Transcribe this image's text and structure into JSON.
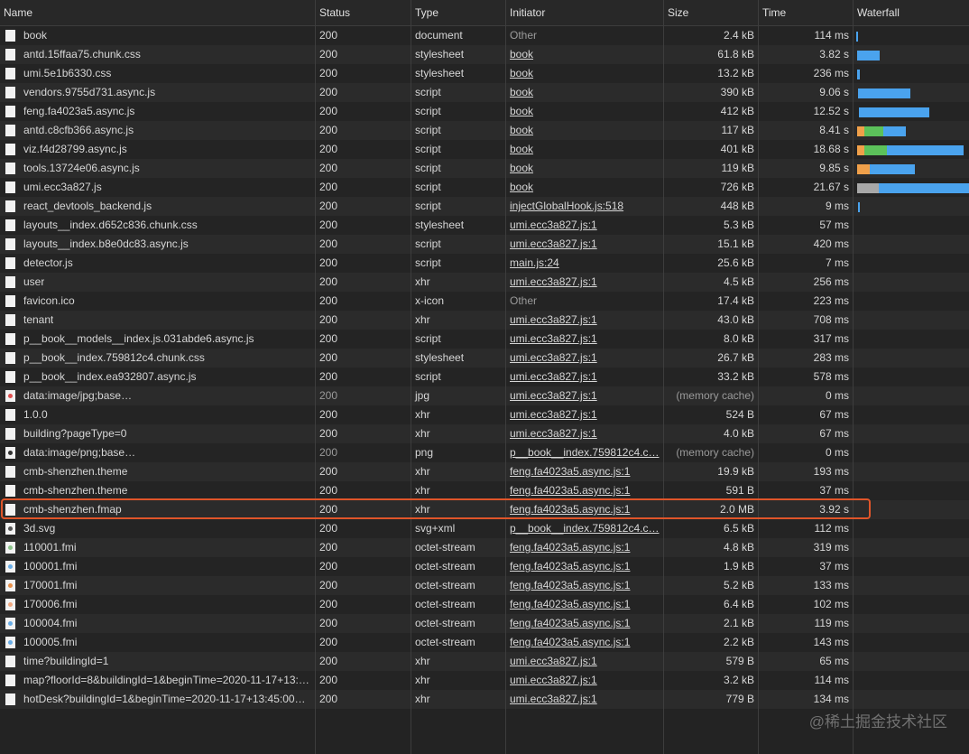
{
  "columns": [
    "Name",
    "Status",
    "Type",
    "Initiator",
    "Size",
    "Time",
    "Waterfall"
  ],
  "colors": {
    "blue": "#4aa3ee",
    "green": "#5cc15a",
    "orange": "#f0a04a",
    "gray": "#a8a8a8",
    "highlight": "#e0552a"
  },
  "rows": [
    {
      "name": "book",
      "status": "200",
      "type": "document",
      "initiator": "Other",
      "size": "2.4 kB",
      "time": "114 ms",
      "icon": "doc",
      "wf": [
        [
          "blue",
          2,
          2
        ]
      ]
    },
    {
      "name": "antd.15ffaa75.chunk.css",
      "status": "200",
      "type": "stylesheet",
      "initiator": "book",
      "size": "61.8 kB",
      "time": "3.82 s",
      "icon": "doc",
      "wf": [
        [
          "blue",
          3,
          20
        ]
      ]
    },
    {
      "name": "umi.5e1b6330.css",
      "status": "200",
      "type": "stylesheet",
      "initiator": "book",
      "size": "13.2 kB",
      "time": "236 ms",
      "icon": "doc",
      "wf": [
        [
          "blue",
          3,
          2.5
        ]
      ]
    },
    {
      "name": "vendors.9755d731.async.js",
      "status": "200",
      "type": "script",
      "initiator": "book",
      "size": "390 kB",
      "time": "9.06 s",
      "icon": "doc",
      "wf": [
        [
          "blue",
          4,
          45
        ]
      ]
    },
    {
      "name": "feng.fa4023a5.async.js",
      "status": "200",
      "type": "script",
      "initiator": "book",
      "size": "412 kB",
      "time": "12.52 s",
      "icon": "doc",
      "wf": [
        [
          "blue",
          5,
          61
        ]
      ]
    },
    {
      "name": "antd.c8cfb366.async.js",
      "status": "200",
      "type": "script",
      "initiator": "book",
      "size": "117 kB",
      "time": "8.41 s",
      "icon": "doc",
      "wf": [
        [
          "orange",
          3,
          6
        ],
        [
          "green",
          9,
          17
        ],
        [
          "blue",
          26,
          19
        ]
      ]
    },
    {
      "name": "viz.f4d28799.async.js",
      "status": "200",
      "type": "script",
      "initiator": "book",
      "size": "401 kB",
      "time": "18.68 s",
      "icon": "doc",
      "wf": [
        [
          "orange",
          3,
          6
        ],
        [
          "green",
          9,
          20
        ],
        [
          "blue",
          29,
          66
        ]
      ]
    },
    {
      "name": "tools.13724e06.async.js",
      "status": "200",
      "type": "script",
      "initiator": "book",
      "size": "119 kB",
      "time": "9.85 s",
      "icon": "doc",
      "wf": [
        [
          "orange",
          3,
          11
        ],
        [
          "blue",
          14,
          39
        ]
      ]
    },
    {
      "name": "umi.ecc3a827.js",
      "status": "200",
      "type": "script",
      "initiator": "book",
      "size": "726 kB",
      "time": "21.67 s",
      "icon": "doc",
      "wf": [
        [
          "gray",
          3,
          19
        ],
        [
          "blue",
          22,
          78
        ]
      ]
    },
    {
      "name": "react_devtools_backend.js",
      "status": "200",
      "type": "script",
      "initiator": "injectGlobalHook.js:518",
      "size": "448 kB",
      "time": "9 ms",
      "icon": "doc",
      "wf": [
        [
          "blue",
          4,
          1.5
        ]
      ]
    },
    {
      "name": "layouts__index.d652c836.chunk.css",
      "status": "200",
      "type": "stylesheet",
      "initiator": "umi.ecc3a827.js:1",
      "size": "5.3 kB",
      "time": "57 ms",
      "icon": "doc",
      "wf": []
    },
    {
      "name": "layouts__index.b8e0dc83.async.js",
      "status": "200",
      "type": "script",
      "initiator": "umi.ecc3a827.js:1",
      "size": "15.1 kB",
      "time": "420 ms",
      "icon": "doc",
      "wf": []
    },
    {
      "name": "detector.js",
      "status": "200",
      "type": "script",
      "initiator": "main.js:24",
      "size": "25.6 kB",
      "time": "7 ms",
      "icon": "doc",
      "wf": []
    },
    {
      "name": "user",
      "status": "200",
      "type": "xhr",
      "initiator": "umi.ecc3a827.js:1",
      "size": "4.5 kB",
      "time": "256 ms",
      "icon": "blank",
      "wf": []
    },
    {
      "name": "favicon.ico",
      "status": "200",
      "type": "x-icon",
      "initiator": "Other",
      "size": "17.4 kB",
      "time": "223 ms",
      "icon": "blank",
      "wf": []
    },
    {
      "name": "tenant",
      "status": "200",
      "type": "xhr",
      "initiator": "umi.ecc3a827.js:1",
      "size": "43.0 kB",
      "time": "708 ms",
      "icon": "blank",
      "wf": []
    },
    {
      "name": "p__book__models__index.js.031abde6.async.js",
      "status": "200",
      "type": "script",
      "initiator": "umi.ecc3a827.js:1",
      "size": "8.0 kB",
      "time": "317 ms",
      "icon": "doc",
      "wf": []
    },
    {
      "name": "p__book__index.759812c4.chunk.css",
      "status": "200",
      "type": "stylesheet",
      "initiator": "umi.ecc3a827.js:1",
      "size": "26.7 kB",
      "time": "283 ms",
      "icon": "doc",
      "wf": []
    },
    {
      "name": "p__book__index.ea932807.async.js",
      "status": "200",
      "type": "script",
      "initiator": "umi.ecc3a827.js:1",
      "size": "33.2 kB",
      "time": "578 ms",
      "icon": "doc",
      "wf": []
    },
    {
      "name": "data:image/jpg;base…",
      "status": "200",
      "type": "jpg",
      "initiator": "umi.ecc3a827.js:1",
      "size": "(memory cache)",
      "time": "0 ms",
      "icon": "jpg",
      "dim": true,
      "wf": []
    },
    {
      "name": "1.0.0",
      "status": "200",
      "type": "xhr",
      "initiator": "umi.ecc3a827.js:1",
      "size": "524 B",
      "time": "67 ms",
      "icon": "blank",
      "wf": []
    },
    {
      "name": "building?pageType=0",
      "status": "200",
      "type": "xhr",
      "initiator": "umi.ecc3a827.js:1",
      "size": "4.0 kB",
      "time": "67 ms",
      "icon": "blank",
      "wf": []
    },
    {
      "name": "data:image/png;base…",
      "status": "200",
      "type": "png",
      "initiator": "p__book__index.759812c4.c…",
      "size": "(memory cache)",
      "time": "0 ms",
      "icon": "png",
      "dim": true,
      "wf": []
    },
    {
      "name": "cmb-shenzhen.theme",
      "status": "200",
      "type": "xhr",
      "initiator": "feng.fa4023a5.async.js:1",
      "size": "19.9 kB",
      "time": "193 ms",
      "icon": "blank",
      "wf": []
    },
    {
      "name": "cmb-shenzhen.theme",
      "status": "200",
      "type": "xhr",
      "initiator": "feng.fa4023a5.async.js:1",
      "size": "591 B",
      "time": "37 ms",
      "icon": "blank",
      "wf": []
    },
    {
      "name": "cmb-shenzhen.fmap",
      "status": "200",
      "type": "xhr",
      "initiator": "feng.fa4023a5.async.js:1",
      "size": "2.0 MB",
      "time": "3.92 s",
      "icon": "blank",
      "wf": []
    },
    {
      "name": "3d.svg",
      "status": "200",
      "type": "svg+xml",
      "initiator": "p__book__index.759812c4.c…",
      "size": "6.5 kB",
      "time": "112 ms",
      "icon": "svg",
      "wf": []
    },
    {
      "name": "110001.fmi",
      "status": "200",
      "type": "octet-stream",
      "initiator": "feng.fa4023a5.async.js:1",
      "size": "4.8 kB",
      "time": "319 ms",
      "icon": "green",
      "wf": []
    },
    {
      "name": "100001.fmi",
      "status": "200",
      "type": "octet-stream",
      "initiator": "feng.fa4023a5.async.js:1",
      "size": "1.9 kB",
      "time": "37 ms",
      "icon": "lblue",
      "wf": []
    },
    {
      "name": "170001.fmi",
      "status": "200",
      "type": "octet-stream",
      "initiator": "feng.fa4023a5.async.js:1",
      "size": "5.2 kB",
      "time": "133 ms",
      "icon": "orange",
      "wf": []
    },
    {
      "name": "170006.fmi",
      "status": "200",
      "type": "octet-stream",
      "initiator": "feng.fa4023a5.async.js:1",
      "size": "6.4 kB",
      "time": "102 ms",
      "icon": "peach",
      "wf": []
    },
    {
      "name": "100004.fmi",
      "status": "200",
      "type": "octet-stream",
      "initiator": "feng.fa4023a5.async.js:1",
      "size": "2.1 kB",
      "time": "119 ms",
      "icon": "lblue",
      "wf": []
    },
    {
      "name": "100005.fmi",
      "status": "200",
      "type": "octet-stream",
      "initiator": "feng.fa4023a5.async.js:1",
      "size": "2.2 kB",
      "time": "143 ms",
      "icon": "lblue",
      "wf": []
    },
    {
      "name": "time?buildingId=1",
      "status": "200",
      "type": "xhr",
      "initiator": "umi.ecc3a827.js:1",
      "size": "579 B",
      "time": "65 ms",
      "icon": "blank",
      "wf": []
    },
    {
      "name": "map?floorId=8&buildingId=1&beginTime=2020-11-17+13:…",
      "status": "200",
      "type": "xhr",
      "initiator": "umi.ecc3a827.js:1",
      "size": "3.2 kB",
      "time": "114 ms",
      "icon": "blank",
      "wf": []
    },
    {
      "name": "hotDesk?buildingId=1&beginTime=2020-11-17+13:45:00…",
      "status": "200",
      "type": "xhr",
      "initiator": "umi.ecc3a827.js:1",
      "size": "779 B",
      "time": "134 ms",
      "icon": "blank",
      "wf": []
    }
  ],
  "watermark": "@稀土掘金技术社区"
}
